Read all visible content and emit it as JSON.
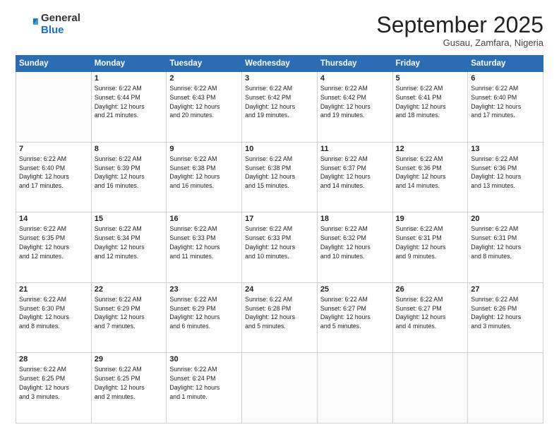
{
  "header": {
    "logo_general": "General",
    "logo_blue": "Blue",
    "month": "September 2025",
    "location": "Gusau, Zamfara, Nigeria"
  },
  "days_of_week": [
    "Sunday",
    "Monday",
    "Tuesday",
    "Wednesday",
    "Thursday",
    "Friday",
    "Saturday"
  ],
  "weeks": [
    [
      {
        "num": "",
        "info": ""
      },
      {
        "num": "1",
        "info": "Sunrise: 6:22 AM\nSunset: 6:44 PM\nDaylight: 12 hours\nand 21 minutes."
      },
      {
        "num": "2",
        "info": "Sunrise: 6:22 AM\nSunset: 6:43 PM\nDaylight: 12 hours\nand 20 minutes."
      },
      {
        "num": "3",
        "info": "Sunrise: 6:22 AM\nSunset: 6:42 PM\nDaylight: 12 hours\nand 19 minutes."
      },
      {
        "num": "4",
        "info": "Sunrise: 6:22 AM\nSunset: 6:42 PM\nDaylight: 12 hours\nand 19 minutes."
      },
      {
        "num": "5",
        "info": "Sunrise: 6:22 AM\nSunset: 6:41 PM\nDaylight: 12 hours\nand 18 minutes."
      },
      {
        "num": "6",
        "info": "Sunrise: 6:22 AM\nSunset: 6:40 PM\nDaylight: 12 hours\nand 17 minutes."
      }
    ],
    [
      {
        "num": "7",
        "info": "Sunrise: 6:22 AM\nSunset: 6:40 PM\nDaylight: 12 hours\nand 17 minutes."
      },
      {
        "num": "8",
        "info": "Sunrise: 6:22 AM\nSunset: 6:39 PM\nDaylight: 12 hours\nand 16 minutes."
      },
      {
        "num": "9",
        "info": "Sunrise: 6:22 AM\nSunset: 6:38 PM\nDaylight: 12 hours\nand 16 minutes."
      },
      {
        "num": "10",
        "info": "Sunrise: 6:22 AM\nSunset: 6:38 PM\nDaylight: 12 hours\nand 15 minutes."
      },
      {
        "num": "11",
        "info": "Sunrise: 6:22 AM\nSunset: 6:37 PM\nDaylight: 12 hours\nand 14 minutes."
      },
      {
        "num": "12",
        "info": "Sunrise: 6:22 AM\nSunset: 6:36 PM\nDaylight: 12 hours\nand 14 minutes."
      },
      {
        "num": "13",
        "info": "Sunrise: 6:22 AM\nSunset: 6:36 PM\nDaylight: 12 hours\nand 13 minutes."
      }
    ],
    [
      {
        "num": "14",
        "info": "Sunrise: 6:22 AM\nSunset: 6:35 PM\nDaylight: 12 hours\nand 12 minutes."
      },
      {
        "num": "15",
        "info": "Sunrise: 6:22 AM\nSunset: 6:34 PM\nDaylight: 12 hours\nand 12 minutes."
      },
      {
        "num": "16",
        "info": "Sunrise: 6:22 AM\nSunset: 6:33 PM\nDaylight: 12 hours\nand 11 minutes."
      },
      {
        "num": "17",
        "info": "Sunrise: 6:22 AM\nSunset: 6:33 PM\nDaylight: 12 hours\nand 10 minutes."
      },
      {
        "num": "18",
        "info": "Sunrise: 6:22 AM\nSunset: 6:32 PM\nDaylight: 12 hours\nand 10 minutes."
      },
      {
        "num": "19",
        "info": "Sunrise: 6:22 AM\nSunset: 6:31 PM\nDaylight: 12 hours\nand 9 minutes."
      },
      {
        "num": "20",
        "info": "Sunrise: 6:22 AM\nSunset: 6:31 PM\nDaylight: 12 hours\nand 8 minutes."
      }
    ],
    [
      {
        "num": "21",
        "info": "Sunrise: 6:22 AM\nSunset: 6:30 PM\nDaylight: 12 hours\nand 8 minutes."
      },
      {
        "num": "22",
        "info": "Sunrise: 6:22 AM\nSunset: 6:29 PM\nDaylight: 12 hours\nand 7 minutes."
      },
      {
        "num": "23",
        "info": "Sunrise: 6:22 AM\nSunset: 6:29 PM\nDaylight: 12 hours\nand 6 minutes."
      },
      {
        "num": "24",
        "info": "Sunrise: 6:22 AM\nSunset: 6:28 PM\nDaylight: 12 hours\nand 5 minutes."
      },
      {
        "num": "25",
        "info": "Sunrise: 6:22 AM\nSunset: 6:27 PM\nDaylight: 12 hours\nand 5 minutes."
      },
      {
        "num": "26",
        "info": "Sunrise: 6:22 AM\nSunset: 6:27 PM\nDaylight: 12 hours\nand 4 minutes."
      },
      {
        "num": "27",
        "info": "Sunrise: 6:22 AM\nSunset: 6:26 PM\nDaylight: 12 hours\nand 3 minutes."
      }
    ],
    [
      {
        "num": "28",
        "info": "Sunrise: 6:22 AM\nSunset: 6:25 PM\nDaylight: 12 hours\nand 3 minutes."
      },
      {
        "num": "29",
        "info": "Sunrise: 6:22 AM\nSunset: 6:25 PM\nDaylight: 12 hours\nand 2 minutes."
      },
      {
        "num": "30",
        "info": "Sunrise: 6:22 AM\nSunset: 6:24 PM\nDaylight: 12 hours\nand 1 minute."
      },
      {
        "num": "",
        "info": ""
      },
      {
        "num": "",
        "info": ""
      },
      {
        "num": "",
        "info": ""
      },
      {
        "num": "",
        "info": ""
      }
    ]
  ]
}
